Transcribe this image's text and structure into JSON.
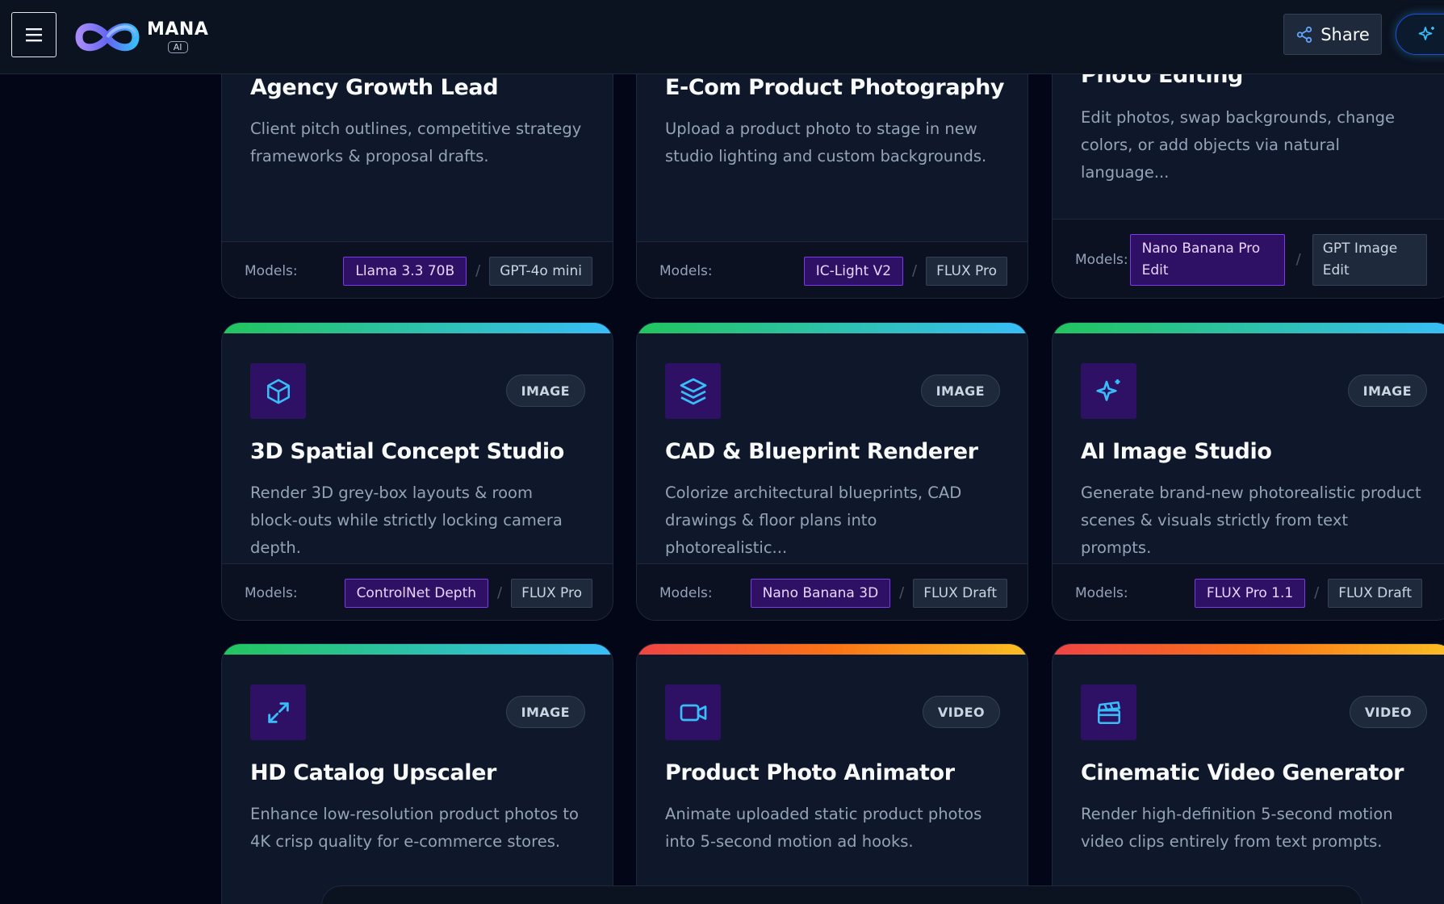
{
  "app": {
    "logo_name": "MANA",
    "logo_sub": "AI",
    "share_label": "Share"
  },
  "models_label": "Models:",
  "cards": [
    {
      "title": "Agency Growth Lead",
      "description": "Client pitch outlines, competitive strategy frameworks & proposal drafts.",
      "models": [
        "Llama 3.3 70B",
        "GPT-4o mini"
      ]
    },
    {
      "title": "E-Com Product Photography",
      "description": "Upload a product photo to stage in new studio lighting and custom backgrounds.",
      "models": [
        "IC-Light V2",
        "FLUX Pro"
      ]
    },
    {
      "title": "Photo Editing",
      "description": "Edit photos, swap backgrounds, change colors, or add objects via natural language...",
      "models": [
        "Nano Banana Pro Edit",
        "GPT Image Edit"
      ]
    },
    {
      "title": "3D Spatial Concept Studio",
      "badge": "IMAGE",
      "icon": "cube-icon",
      "accent": "#22c55e",
      "description": "Render 3D grey-box layouts & room block-outs while strictly locking camera depth.",
      "models": [
        "ControlNet Depth",
        "FLUX Pro"
      ]
    },
    {
      "title": "CAD & Blueprint Renderer",
      "badge": "IMAGE",
      "icon": "layers-icon",
      "accent": "#22c55e",
      "description": "Colorize architectural blueprints, CAD drawings & floor plans into photorealistic...",
      "models": [
        "Nano Banana 3D",
        "FLUX Draft"
      ]
    },
    {
      "title": "AI Image Studio",
      "badge": "IMAGE",
      "icon": "sparkles-icon",
      "accent": "#22c55e",
      "description": "Generate brand-new photorealistic product scenes & visuals strictly from text prompts.",
      "models": [
        "FLUX Pro 1.1",
        "FLUX Draft"
      ]
    },
    {
      "title": "HD Catalog Upscaler",
      "badge": "IMAGE",
      "icon": "expand-icon",
      "accent": "#22c55e",
      "description": "Enhance low-resolution product photos to 4K crisp quality for e-commerce stores."
    },
    {
      "title": "Product Photo Animator",
      "badge": "VIDEO",
      "icon": "video-camera-icon",
      "accent": "#ef4444",
      "description": "Animate uploaded static product photos into 5-second motion ad hooks."
    },
    {
      "title": "Cinematic Video Generator",
      "badge": "VIDEO",
      "icon": "clapperboard-icon",
      "accent": "#ef4444",
      "description": "Render high-definition 5-second motion video clips entirely from text prompts."
    }
  ]
}
